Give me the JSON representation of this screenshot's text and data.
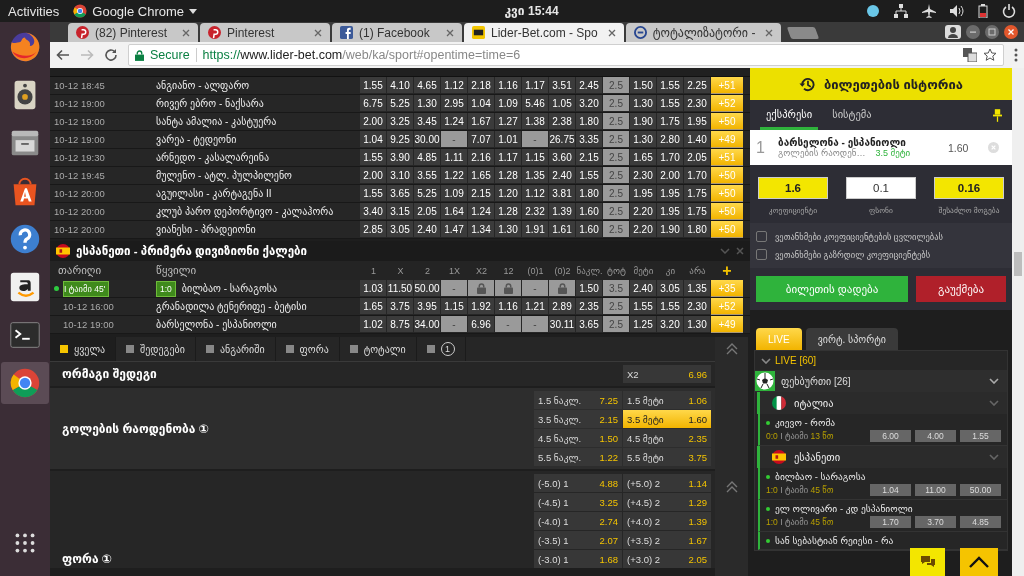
{
  "topbar": {
    "activities": "Activities",
    "app": "Google Chrome",
    "clock": "კვი 15:44"
  },
  "dock": [
    {
      "kind": "firefox",
      "selected": false
    },
    {
      "kind": "speaker",
      "selected": false
    },
    {
      "kind": "files",
      "selected": false
    },
    {
      "kind": "store",
      "selected": false
    },
    {
      "kind": "help",
      "selected": false
    },
    {
      "kind": "amazon",
      "selected": false
    },
    {
      "kind": "terminal",
      "selected": false
    },
    {
      "kind": "chrome",
      "selected": true
    },
    {
      "kind": "apps",
      "selected": false
    }
  ],
  "browser": {
    "tabs": [
      {
        "title": "(82) Pinterest",
        "selected": false
      },
      {
        "title": "Pinterest",
        "selected": false
      },
      {
        "title": "(1) Facebook",
        "selected": false
      },
      {
        "title": "Lider-Bet.com - Spo",
        "selected": true
      },
      {
        "title": "ტოტალიზატორი -",
        "selected": false
      }
    ],
    "secure": "Secure",
    "url": {
      "scheme": "https://",
      "host": "www.lider-bet.com",
      "path": "/web/ka/sport#opentime=time=6"
    }
  },
  "top_table": {
    "rows": [
      {
        "date": "10-12 18:45",
        "match": "ანგიანო - ალფარო",
        "cells": [
          "1.55",
          "4.10",
          "4.65",
          "1.12",
          "2.18",
          "1.16",
          "1.17",
          "3.51",
          "2.45",
          "2.5",
          "1.50",
          "1.55",
          "2.25"
        ],
        "more": "+51"
      },
      {
        "date": "10-12 19:00",
        "match": "რივერ ებრო - ნაქსარა",
        "cells": [
          "6.75",
          "5.25",
          "1.30",
          "2.95",
          "1.04",
          "1.09",
          "5.46",
          "1.05",
          "3.20",
          "2.5",
          "1.30",
          "1.55",
          "2.30"
        ],
        "more": "+52"
      },
      {
        "date": "10-12 19:00",
        "match": "სანტა ამალია - კასტუერა",
        "cells": [
          "2.00",
          "3.25",
          "3.45",
          "1.24",
          "1.67",
          "1.27",
          "1.38",
          "2.38",
          "1.80",
          "2.5",
          "1.90",
          "1.75",
          "1.95"
        ],
        "more": "+50"
      },
      {
        "date": "10-12 19:00",
        "match": "ვარეა - ტედეონი",
        "cells": [
          "1.04",
          "9.25",
          "30.00",
          "-",
          "7.07",
          "1.01",
          "-",
          "26.75",
          "3.35",
          "2.5",
          "1.30",
          "2.80",
          "1.40"
        ],
        "more": "+49"
      },
      {
        "date": "10-12 19:30",
        "match": "არნედო - კასალარეინა",
        "cells": [
          "1.55",
          "3.90",
          "4.85",
          "1.11",
          "2.16",
          "1.17",
          "1.15",
          "3.60",
          "2.15",
          "2.5",
          "1.65",
          "1.70",
          "2.05"
        ],
        "more": "+51"
      },
      {
        "date": "10-12 19:45",
        "match": "მულენო - ატლ. პულპილენო",
        "cells": [
          "2.00",
          "3.10",
          "3.55",
          "1.22",
          "1.65",
          "1.28",
          "1.35",
          "2.40",
          "1.55",
          "2.5",
          "2.30",
          "2.00",
          "1.70"
        ],
        "more": "+50"
      },
      {
        "date": "10-12 20:00",
        "match": "აგუილასი - კარტაგენა II",
        "cells": [
          "1.55",
          "3.65",
          "5.25",
          "1.09",
          "2.15",
          "1.20",
          "1.12",
          "3.81",
          "1.80",
          "2.5",
          "1.95",
          "1.95",
          "1.75"
        ],
        "more": "+50"
      },
      {
        "date": "10-12 20:00",
        "match": "კლუბ პარო დეპორტივო - კალაჰორა",
        "cells": [
          "3.40",
          "3.15",
          "2.05",
          "1.64",
          "1.24",
          "1.28",
          "2.32",
          "1.39",
          "1.60",
          "2.5",
          "2.20",
          "1.95",
          "1.75"
        ],
        "more": "+50"
      },
      {
        "date": "10-12 20:00",
        "match": "ვიანესი - პრადეიონი",
        "cells": [
          "2.85",
          "3.05",
          "2.40",
          "1.47",
          "1.34",
          "1.30",
          "1.91",
          "1.61",
          "1.60",
          "2.5",
          "2.20",
          "1.90",
          "1.80"
        ],
        "more": "+50"
      }
    ]
  },
  "league": {
    "title": "ესპანეთი - პრიმერა დივიზიონი ქალები",
    "date_header": "თარიღი",
    "pair_header": "წყვილი",
    "odds_columns": [
      "1",
      "X",
      "2",
      "1X",
      "X2",
      "12",
      "(0)1",
      "(0)2",
      "ნაკლ.",
      "ტოტ",
      "მეტი",
      "კი",
      "არა"
    ],
    "add": "+",
    "rows": [
      {
        "live": true,
        "time": "I ტაიმი 45'",
        "score": "1:0",
        "match": "ბილბაო - სარაგოსა",
        "cells": [
          "1.03",
          "11.50",
          "50.00",
          "-",
          {
            "kind": "lock"
          },
          {
            "kind": "lock"
          },
          "-",
          {
            "kind": "lock"
          },
          "1.50",
          "3.5",
          "2.40",
          "3.05",
          "1.35"
        ],
        "more": "+35"
      },
      {
        "live": false,
        "date": "10-12 16:00",
        "match": "გრანადილა ტენერიფე - ბეტისი",
        "cells": [
          "1.65",
          "3.75",
          "3.95",
          "1.15",
          "1.92",
          "1.16",
          "1.21",
          "2.89",
          "2.35",
          "2.5",
          "1.55",
          "1.55",
          "2.30"
        ],
        "more": "+52"
      },
      {
        "live": false,
        "date": "10-12 19:00",
        "match": "ბარსელონა - ესპანიოლი",
        "cells": [
          "1.02",
          "8.75",
          "34.00",
          "-",
          "6.96",
          "-",
          "-",
          "30.11",
          "3.65",
          "2.5",
          "1.25",
          "3.20",
          "1.30"
        ],
        "more": "+49"
      }
    ]
  },
  "market_tabs": [
    {
      "label": "ყველა",
      "selected": true
    },
    {
      "label": "შედეგები",
      "selected": false
    },
    {
      "label": "ანგარიში",
      "selected": false
    },
    {
      "label": "ფორა",
      "selected": false
    },
    {
      "label": "ტოტალი",
      "selected": false
    },
    {
      "label": "1",
      "kind": "circle",
      "selected": false
    }
  ],
  "markets": [
    {
      "title": "ორმაგი შედეგი",
      "rows": [
        [
          {
            "label": "X2",
            "odd": "6.96",
            "selected": false
          }
        ]
      ]
    },
    {
      "title": "გოლების რაოდენობა ①",
      "rows": [
        [
          {
            "label": "1.5 ნაკლ.",
            "odd": "7.25",
            "selected": false
          },
          {
            "label": "1.5 მეტი",
            "odd": "1.06",
            "selected": false
          }
        ],
        [
          {
            "label": "3.5 ნაკლ.",
            "odd": "2.15",
            "selected": false
          },
          {
            "label": "3.5 მეტი",
            "odd": "1.60",
            "selected": true
          }
        ],
        [
          {
            "label": "4.5 ნაკლ.",
            "odd": "1.50",
            "selected": false
          },
          {
            "label": "4.5 მეტი",
            "odd": "2.35",
            "selected": false
          }
        ],
        [
          {
            "label": "5.5 ნაკლ.",
            "odd": "1.22",
            "selected": false
          },
          {
            "label": "5.5 მეტი",
            "odd": "3.75",
            "selected": false
          }
        ]
      ]
    },
    {
      "title": "ფორა ①",
      "rows": [
        [
          {
            "label": "(-5.0) 1",
            "odd": "4.88",
            "selected": false
          },
          {
            "label": "(+5.0) 2",
            "odd": "1.14",
            "selected": false
          }
        ],
        [
          {
            "label": "(-4.5) 1",
            "odd": "3.25",
            "selected": false
          },
          {
            "label": "(+4.5) 2",
            "odd": "1.29",
            "selected": false
          }
        ],
        [
          {
            "label": "(-4.0) 1",
            "odd": "2.74",
            "selected": false
          },
          {
            "label": "(+4.0) 2",
            "odd": "1.39",
            "selected": false
          }
        ],
        [
          {
            "label": "(-3.5) 1",
            "odd": "2.07",
            "selected": false
          },
          {
            "label": "(+3.5) 2",
            "odd": "1.67",
            "selected": false
          }
        ],
        [
          {
            "label": "(-3.0) 1",
            "odd": "1.68",
            "selected": false
          },
          {
            "label": "(+3.0) 2",
            "odd": "2.05",
            "selected": false
          }
        ]
      ]
    }
  ],
  "bet_slip": {
    "title": "ბილეთების ისტორია",
    "tabs": [
      {
        "label": "ექსპრესი",
        "selected": true
      },
      {
        "label": "სისტემა",
        "selected": false
      }
    ],
    "bet": {
      "index": "1",
      "match": "ბარსელონა - ესპანიოლი",
      "market": "გოლების რაოდენ…",
      "pick": "3.5 მეტი",
      "odd": "1.60"
    },
    "fields": [
      {
        "label": "კოეფიციენტი",
        "value": "1.6",
        "kind": "readonly"
      },
      {
        "label": "ფსონი",
        "value": "0.1",
        "kind": "input"
      },
      {
        "label": "შესაძლო მოგება",
        "value": "0.16",
        "kind": "readonly"
      }
    ],
    "agreements": [
      {
        "label": "ვეთანხმები კოეფიციენტების ცვლილებას",
        "checked": false
      },
      {
        "label": "ვეთანხმები გაზრდილ კოეფიციენტებს",
        "checked": false
      }
    ],
    "place": "ბილეთის დადება",
    "cancel": "გაუქმება"
  },
  "live": {
    "tabs": [
      {
        "label": "LIVE",
        "selected": true
      },
      {
        "label": "ვირტ. სპორტი",
        "selected": false
      }
    ],
    "header": "LIVE [60]",
    "sport": "ფეხბურთი [26]",
    "countries": [
      {
        "name": "იტალია",
        "matches": [
          {
            "name": "კიევო - რომა",
            "score": "0:0",
            "period": "I ტაიმი",
            "minute": "13 წთ",
            "odds": [
              "6.00",
              "4.00",
              "1.55"
            ]
          }
        ]
      },
      {
        "name": "ესპანეთი",
        "matches": [
          {
            "name": "ბილბაო - სარაგოსა",
            "score": "1:0",
            "period": "I ტაიმი",
            "minute": "45 წთ",
            "odds": [
              "1.04",
              "11.00",
              "50.00"
            ]
          },
          {
            "name": "ელ ოლივარი - კდ ესპანიოლი",
            "score": "1:0",
            "period": "I ტაიმი",
            "minute": "45 წთ",
            "odds": [
              "1.70",
              "3.70",
              "4.85"
            ]
          },
          {
            "name": "სან სებასტიან რეიესი - რა"
          }
        ]
      }
    ]
  }
}
